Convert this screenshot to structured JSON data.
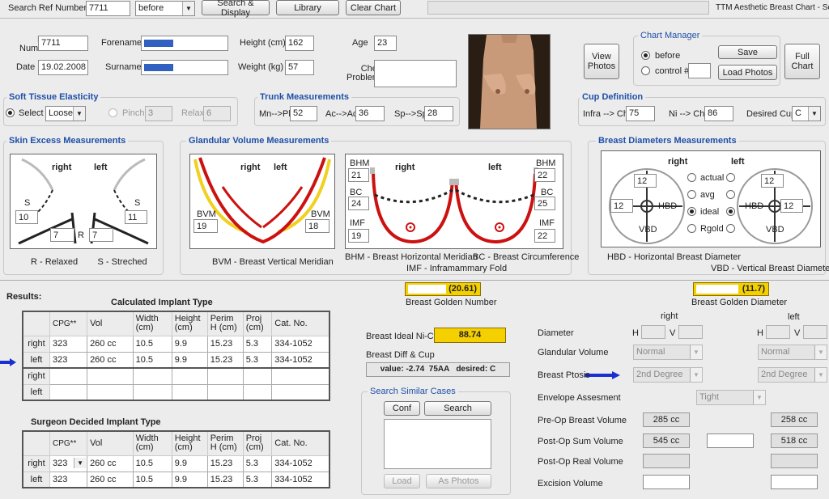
{
  "toolbar": {
    "search_label": "Search Ref Number",
    "search_value": "7711",
    "mode_value": "before",
    "search_display": "Search & Display",
    "library": "Library",
    "clear_chart": "Clear Chart",
    "title": "TTM Aesthetic Breast Chart - Ser"
  },
  "patient": {
    "ref_label": "Ref\nNumber",
    "ref_value": "7711",
    "forename_label": "Forename",
    "height_label": "Height (cm)",
    "height_value": "162",
    "age_label": "Age",
    "age_value": "23",
    "date_label": "Date",
    "date_value": "19.02.2008",
    "surname_label": "Surname",
    "weight_label": "Weight (kg)",
    "weight_value": "57",
    "chest_label": "Chest\nProblems",
    "chest_value": ""
  },
  "actions": {
    "view_photos": "View\nPhotos",
    "chart_manager_title": "Chart Manager",
    "before_label": "before",
    "control_label": "control #",
    "save": "Save",
    "load_photos": "Load Photos",
    "full_chart": "Full\nChart"
  },
  "soft_tissue": {
    "title": "Soft Tissue Elasticity",
    "select_label": "Select",
    "select_value": "Loose",
    "pinch_label": "Pinch",
    "pinch_value": "3",
    "relax_label": "Relax",
    "relax_value": "6"
  },
  "trunk": {
    "title": "Trunk Measurements",
    "mn_pb_label": "Mn-->Pb",
    "mn_pb_value": "52",
    "ac_ac_label": "Ac-->Ac",
    "ac_ac_value": "36",
    "sp_sp_label": "Sp-->Sp",
    "sp_sp_value": "28"
  },
  "cup": {
    "title": "Cup Definition",
    "infra_label": "Infra --> Ch",
    "infra_value": "75",
    "ni_label": "Ni --> Ch",
    "ni_value": "86",
    "desired_label": "Desired Cup",
    "desired_value": "C"
  },
  "skin": {
    "title": "Skin Excess Measurements",
    "right": "right",
    "left": "left",
    "s_right_label": "S",
    "s_right_value": "10",
    "s_left_label": "S",
    "s_left_value": "11",
    "r_label": "R",
    "r_right_value": "7",
    "r_left_value": "7",
    "caption": "R - Relaxed        S - Streched"
  },
  "glandular": {
    "title": "Glandular Volume Measurements",
    "right": "right",
    "left": "left",
    "bvm_label": "BVM",
    "bvm_right": "19",
    "bvm_left": "18",
    "caption": "BVM - Breast Vertical Meridian",
    "bhm_label": "BHM",
    "bhm_right": "21",
    "bhm_left": "22",
    "bc_label": "BC",
    "bc_right": "24",
    "bc_left": "25",
    "imf_label": "IMF",
    "imf_right": "19",
    "imf_left": "22",
    "caption2": "BHM - Breast Horizontal Meridian",
    "caption3": "BC - Breast Circumference",
    "caption4": "IMF - Inframammary Fold"
  },
  "diameters": {
    "title": "Breast Diameters Measurements",
    "right": "right",
    "left": "left",
    "val_top_r": "12",
    "val_left_r": "12",
    "val_top_l": "12",
    "val_right_l": "12",
    "hbd": "HBD",
    "vbd": "VBD",
    "options": [
      "actual",
      "avg",
      "ideal",
      "Rgold"
    ],
    "selected": "ideal",
    "caption1": "HBD - Horizontal Breast Diameter",
    "caption2": "VBD - Vertical Breast Diameter",
    "golden_value": "(11.7)",
    "golden_label": "Breast Golden Diameter",
    "golden_fill": 0.6
  },
  "results": {
    "label": "Results:",
    "golden_number_value": "(20.61)",
    "golden_number_label": "Breast Golden Number",
    "golden_number_fill": 0.55,
    "calc_title": "Calculated Implant Type",
    "headers": [
      "CPG**",
      "Vol",
      "Width\n(cm)",
      "Height\n(cm)",
      "Perim\nH (cm)",
      "Proj\n(cm)",
      "Cat. No."
    ],
    "calc_rows": [
      {
        "side": "right",
        "cells": [
          "323",
          "260 cc",
          "10.5",
          "9.9",
          "15.23",
          "5.3",
          "334-1052"
        ]
      },
      {
        "side": "left",
        "cells": [
          "323",
          "260 cc",
          "10.5",
          "9.9",
          "15.23",
          "5.3",
          "334-1052"
        ]
      },
      {
        "side": "right",
        "cells": [
          "",
          "",
          "",
          "",
          "",
          "",
          ""
        ]
      },
      {
        "side": "left",
        "cells": [
          "",
          "",
          "",
          "",
          "",
          "",
          ""
        ]
      }
    ],
    "surgeon_title": "Surgeon Decided Implant Type",
    "surgeon_rows": [
      {
        "side": "right",
        "cells": [
          "323",
          "260 cc",
          "10.5",
          "9.9",
          "15.23",
          "5.3",
          "334-1052"
        ]
      },
      {
        "side": "left",
        "cells": [
          "323",
          "260 cc",
          "10.5",
          "9.9",
          "15.23",
          "5.3",
          "334-1052"
        ]
      }
    ],
    "ideal_label": "Breast Ideal Ni-Ch",
    "ideal_value": "88.74",
    "diff_label": "Breast Diff & Cup",
    "diff_value": "value: -2.74  75AA   desired: C",
    "similar_title": "Search Similar Cases",
    "conf": "Conf",
    "search": "Search",
    "load": "Load",
    "as_photos": "As Photos"
  },
  "assessment": {
    "right_label": "right",
    "left_label": "left",
    "h": "H",
    "v": "V",
    "diameter": "Diameter",
    "glandular_volume": "Glandular Volume",
    "gv_right": "Normal",
    "gv_left": "Normal",
    "ptosis": "Breast Ptosis",
    "ptosis_right": "2nd Degree",
    "ptosis_left": "2nd Degree",
    "envelope": "Envelope Assesment",
    "envelope_value": "Tight",
    "preop": "Pre-Op Breast Volume",
    "preop_right": "285 cc",
    "preop_left": "258 cc",
    "postop_sum": "Post-Op Sum Volume",
    "postop_sum_right": "545 cc",
    "postop_sum_left": "518 cc",
    "postop_real": "Post-Op Real Volume",
    "excision": "Excision Volume"
  },
  "colors": {
    "accent": "#1f4fa8",
    "gold": "#f5d000",
    "red": "#cc1111",
    "yellow": "#f0d020",
    "arrow": "#1a2fd0"
  }
}
